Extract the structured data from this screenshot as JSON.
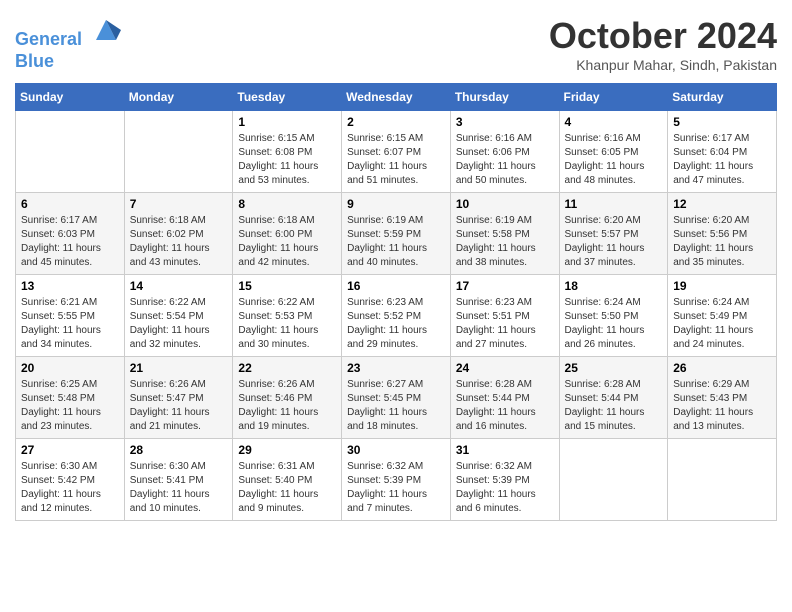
{
  "header": {
    "logo_line1": "General",
    "logo_line2": "Blue",
    "month": "October 2024",
    "location": "Khanpur Mahar, Sindh, Pakistan"
  },
  "days_of_week": [
    "Sunday",
    "Monday",
    "Tuesday",
    "Wednesday",
    "Thursday",
    "Friday",
    "Saturday"
  ],
  "weeks": [
    [
      {
        "day": "",
        "sunrise": "",
        "sunset": "",
        "daylight": ""
      },
      {
        "day": "",
        "sunrise": "",
        "sunset": "",
        "daylight": ""
      },
      {
        "day": "1",
        "sunrise": "Sunrise: 6:15 AM",
        "sunset": "Sunset: 6:08 PM",
        "daylight": "Daylight: 11 hours and 53 minutes."
      },
      {
        "day": "2",
        "sunrise": "Sunrise: 6:15 AM",
        "sunset": "Sunset: 6:07 PM",
        "daylight": "Daylight: 11 hours and 51 minutes."
      },
      {
        "day": "3",
        "sunrise": "Sunrise: 6:16 AM",
        "sunset": "Sunset: 6:06 PM",
        "daylight": "Daylight: 11 hours and 50 minutes."
      },
      {
        "day": "4",
        "sunrise": "Sunrise: 6:16 AM",
        "sunset": "Sunset: 6:05 PM",
        "daylight": "Daylight: 11 hours and 48 minutes."
      },
      {
        "day": "5",
        "sunrise": "Sunrise: 6:17 AM",
        "sunset": "Sunset: 6:04 PM",
        "daylight": "Daylight: 11 hours and 47 minutes."
      }
    ],
    [
      {
        "day": "6",
        "sunrise": "Sunrise: 6:17 AM",
        "sunset": "Sunset: 6:03 PM",
        "daylight": "Daylight: 11 hours and 45 minutes."
      },
      {
        "day": "7",
        "sunrise": "Sunrise: 6:18 AM",
        "sunset": "Sunset: 6:02 PM",
        "daylight": "Daylight: 11 hours and 43 minutes."
      },
      {
        "day": "8",
        "sunrise": "Sunrise: 6:18 AM",
        "sunset": "Sunset: 6:00 PM",
        "daylight": "Daylight: 11 hours and 42 minutes."
      },
      {
        "day": "9",
        "sunrise": "Sunrise: 6:19 AM",
        "sunset": "Sunset: 5:59 PM",
        "daylight": "Daylight: 11 hours and 40 minutes."
      },
      {
        "day": "10",
        "sunrise": "Sunrise: 6:19 AM",
        "sunset": "Sunset: 5:58 PM",
        "daylight": "Daylight: 11 hours and 38 minutes."
      },
      {
        "day": "11",
        "sunrise": "Sunrise: 6:20 AM",
        "sunset": "Sunset: 5:57 PM",
        "daylight": "Daylight: 11 hours and 37 minutes."
      },
      {
        "day": "12",
        "sunrise": "Sunrise: 6:20 AM",
        "sunset": "Sunset: 5:56 PM",
        "daylight": "Daylight: 11 hours and 35 minutes."
      }
    ],
    [
      {
        "day": "13",
        "sunrise": "Sunrise: 6:21 AM",
        "sunset": "Sunset: 5:55 PM",
        "daylight": "Daylight: 11 hours and 34 minutes."
      },
      {
        "day": "14",
        "sunrise": "Sunrise: 6:22 AM",
        "sunset": "Sunset: 5:54 PM",
        "daylight": "Daylight: 11 hours and 32 minutes."
      },
      {
        "day": "15",
        "sunrise": "Sunrise: 6:22 AM",
        "sunset": "Sunset: 5:53 PM",
        "daylight": "Daylight: 11 hours and 30 minutes."
      },
      {
        "day": "16",
        "sunrise": "Sunrise: 6:23 AM",
        "sunset": "Sunset: 5:52 PM",
        "daylight": "Daylight: 11 hours and 29 minutes."
      },
      {
        "day": "17",
        "sunrise": "Sunrise: 6:23 AM",
        "sunset": "Sunset: 5:51 PM",
        "daylight": "Daylight: 11 hours and 27 minutes."
      },
      {
        "day": "18",
        "sunrise": "Sunrise: 6:24 AM",
        "sunset": "Sunset: 5:50 PM",
        "daylight": "Daylight: 11 hours and 26 minutes."
      },
      {
        "day": "19",
        "sunrise": "Sunrise: 6:24 AM",
        "sunset": "Sunset: 5:49 PM",
        "daylight": "Daylight: 11 hours and 24 minutes."
      }
    ],
    [
      {
        "day": "20",
        "sunrise": "Sunrise: 6:25 AM",
        "sunset": "Sunset: 5:48 PM",
        "daylight": "Daylight: 11 hours and 23 minutes."
      },
      {
        "day": "21",
        "sunrise": "Sunrise: 6:26 AM",
        "sunset": "Sunset: 5:47 PM",
        "daylight": "Daylight: 11 hours and 21 minutes."
      },
      {
        "day": "22",
        "sunrise": "Sunrise: 6:26 AM",
        "sunset": "Sunset: 5:46 PM",
        "daylight": "Daylight: 11 hours and 19 minutes."
      },
      {
        "day": "23",
        "sunrise": "Sunrise: 6:27 AM",
        "sunset": "Sunset: 5:45 PM",
        "daylight": "Daylight: 11 hours and 18 minutes."
      },
      {
        "day": "24",
        "sunrise": "Sunrise: 6:28 AM",
        "sunset": "Sunset: 5:44 PM",
        "daylight": "Daylight: 11 hours and 16 minutes."
      },
      {
        "day": "25",
        "sunrise": "Sunrise: 6:28 AM",
        "sunset": "Sunset: 5:44 PM",
        "daylight": "Daylight: 11 hours and 15 minutes."
      },
      {
        "day": "26",
        "sunrise": "Sunrise: 6:29 AM",
        "sunset": "Sunset: 5:43 PM",
        "daylight": "Daylight: 11 hours and 13 minutes."
      }
    ],
    [
      {
        "day": "27",
        "sunrise": "Sunrise: 6:30 AM",
        "sunset": "Sunset: 5:42 PM",
        "daylight": "Daylight: 11 hours and 12 minutes."
      },
      {
        "day": "28",
        "sunrise": "Sunrise: 6:30 AM",
        "sunset": "Sunset: 5:41 PM",
        "daylight": "Daylight: 11 hours and 10 minutes."
      },
      {
        "day": "29",
        "sunrise": "Sunrise: 6:31 AM",
        "sunset": "Sunset: 5:40 PM",
        "daylight": "Daylight: 11 hours and 9 minutes."
      },
      {
        "day": "30",
        "sunrise": "Sunrise: 6:32 AM",
        "sunset": "Sunset: 5:39 PM",
        "daylight": "Daylight: 11 hours and 7 minutes."
      },
      {
        "day": "31",
        "sunrise": "Sunrise: 6:32 AM",
        "sunset": "Sunset: 5:39 PM",
        "daylight": "Daylight: 11 hours and 6 minutes."
      },
      {
        "day": "",
        "sunrise": "",
        "sunset": "",
        "daylight": ""
      },
      {
        "day": "",
        "sunrise": "",
        "sunset": "",
        "daylight": ""
      }
    ]
  ]
}
